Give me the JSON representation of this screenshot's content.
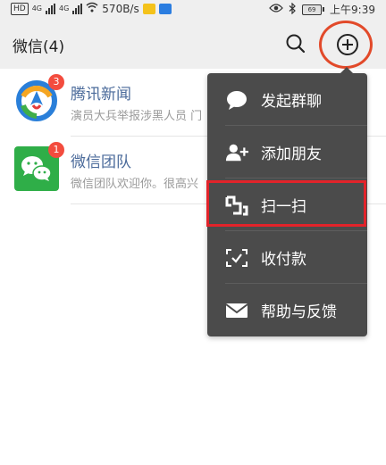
{
  "status_bar": {
    "hd_label": "HD",
    "network1": "4G",
    "network2": "4G",
    "speed": "570B/s",
    "battery": "69",
    "time": "上午9:39"
  },
  "header": {
    "title": "微信(4)",
    "search_icon": "search-icon",
    "plus_icon": "plus-circle-icon"
  },
  "chats": [
    {
      "name": "腾讯新闻",
      "preview": "演员大兵举报涉黑人员 门",
      "badge": "3",
      "avatar_icon": "tencent-news-logo"
    },
    {
      "name": "微信团队",
      "preview": "微信团队欢迎你。很高兴",
      "badge": "1",
      "avatar_icon": "wechat-logo"
    }
  ],
  "menu": {
    "items": [
      {
        "label": "发起群聊",
        "icon": "chat-bubble-icon"
      },
      {
        "label": "添加朋友",
        "icon": "add-friend-icon"
      },
      {
        "label": "扫一扫",
        "icon": "scan-icon"
      },
      {
        "label": "收付款",
        "icon": "payment-scan-icon"
      },
      {
        "label": "帮助与反馈",
        "icon": "mail-icon"
      }
    ]
  },
  "colors": {
    "header_bg": "#efefef",
    "menu_bg": "#4b4b4b",
    "chat_name": "#4a6a9a",
    "badge": "#f34c3e",
    "highlight": "#e2232a"
  }
}
